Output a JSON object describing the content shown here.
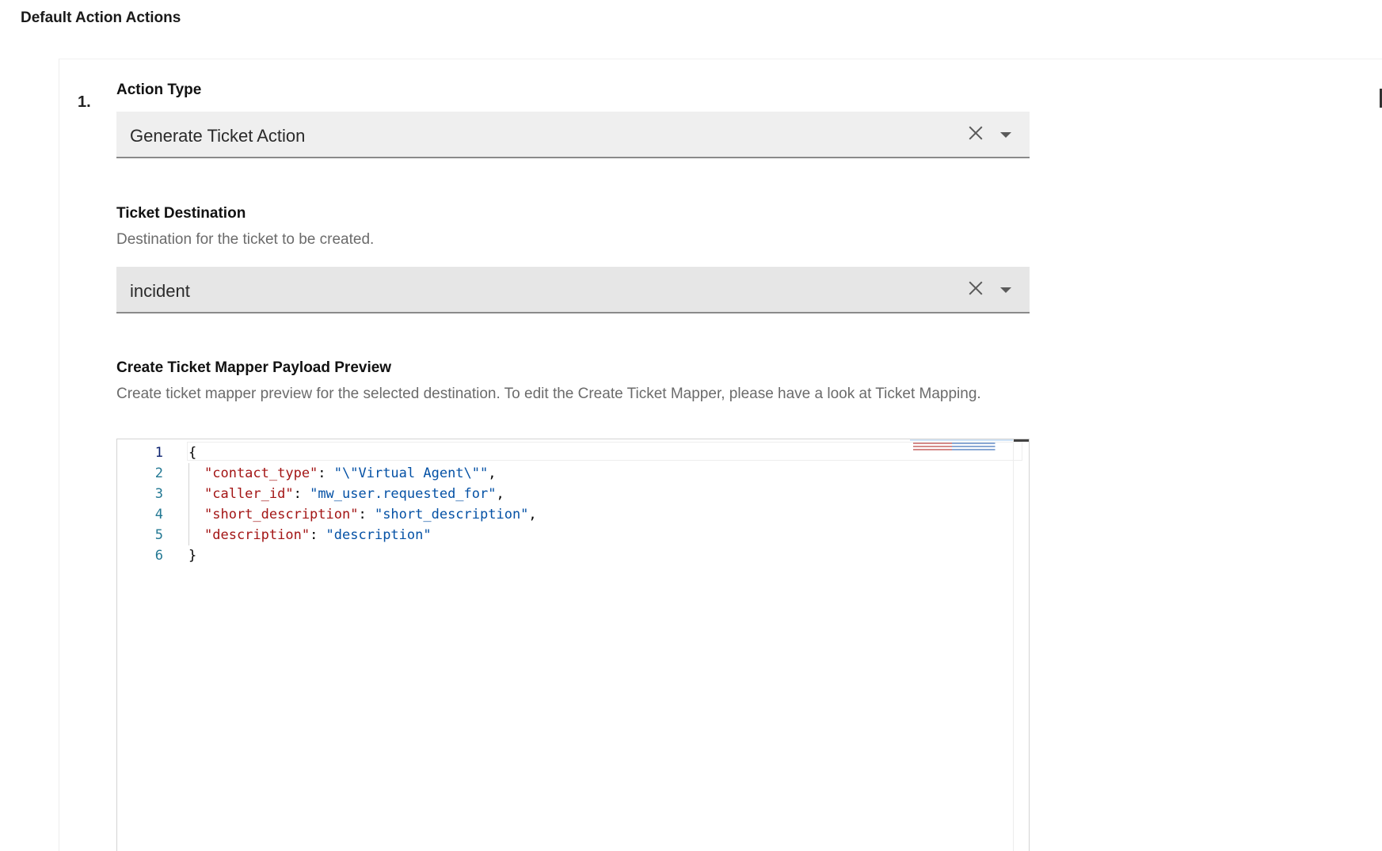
{
  "section": {
    "title": "Default Action Actions"
  },
  "action_item": {
    "number": "1.",
    "action_type": {
      "label": "Action Type",
      "value": "Generate Ticket Action"
    },
    "ticket_destination": {
      "label": "Ticket Destination",
      "description": "Destination for the ticket to be created.",
      "value": "incident"
    },
    "payload_preview": {
      "label": "Create Ticket Mapper Payload Preview",
      "description": "Create ticket mapper preview for the selected destination. To edit the Create Ticket Mapper, please have a look at Ticket Mapping.",
      "line_numbers": [
        "1",
        "2",
        "3",
        "4",
        "5",
        "6"
      ],
      "lines": [
        {
          "open": "{"
        },
        {
          "key": "\"contact_type\"",
          "sep": ": ",
          "value": "\"\\\"Virtual Agent\\\"\"",
          "end": ","
        },
        {
          "key": "\"caller_id\"",
          "sep": ": ",
          "value": "\"mw_user.requested_for\"",
          "end": ","
        },
        {
          "key": "\"short_description\"",
          "sep": ": ",
          "value": "\"short_description\"",
          "end": ","
        },
        {
          "key": "\"description\"",
          "sep": ": ",
          "value": "\"description\"",
          "end": ""
        },
        {
          "close": "}"
        }
      ]
    }
  },
  "icons": {
    "clear": "close-icon",
    "dropdown": "chevron-down-icon"
  },
  "colors": {
    "json_key": "#a31515",
    "json_string": "#0451a5",
    "line_number": "#237893"
  }
}
